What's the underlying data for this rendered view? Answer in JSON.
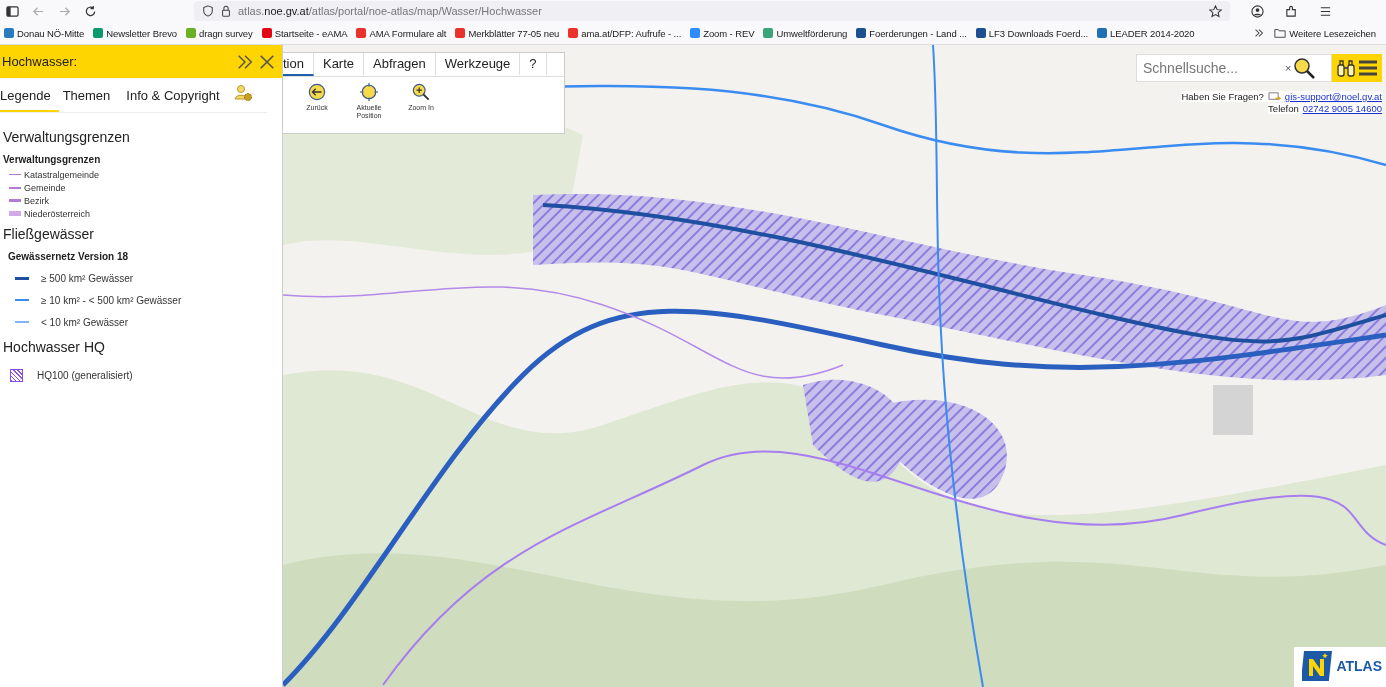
{
  "browser": {
    "url": "atlas.**noe.gv.at**/atlas/portal/noe-atlas/map/Wasser/Hochwasser",
    "bookmarks": [
      {
        "label": "Donau NÖ-Mitte",
        "color": "#2a7ac0"
      },
      {
        "label": "Newsletter Brevo",
        "color": "#0b996e"
      },
      {
        "label": "dragn survey",
        "color": "#6ab023"
      },
      {
        "label": "Startseite - eAMA",
        "color": "#e30613"
      },
      {
        "label": "AMA Formulare alt",
        "color": "#e8322b"
      },
      {
        "label": "Merkblätter 77-05 neu",
        "color": "#e8322b"
      },
      {
        "label": "ama.at/DFP: Aufrufe - ...",
        "color": "#e8322b"
      },
      {
        "label": "Zoom - REV",
        "color": "#2d8cff"
      },
      {
        "label": "Umweltförderung",
        "color": "#3aa57a"
      },
      {
        "label": "Foerderungen - Land ...",
        "color": "#1d4f91"
      },
      {
        "label": "LF3 Downloads Foerd...",
        "color": "#1d4f91"
      },
      {
        "label": "LEADER 2014-2020",
        "color": "#1f6fb5"
      }
    ],
    "other_bookmarks": "Weitere Lesezeichen"
  },
  "panel": {
    "title": "Hochwasser:",
    "tabs": [
      {
        "label": "Legende",
        "selected": true
      },
      {
        "label": "Themen",
        "selected": false
      },
      {
        "label": "Info & Copyright",
        "selected": false
      }
    ],
    "sections": [
      {
        "title": "Verwaltungsgrenzen",
        "subtitle": "Verwaltungsgrenzen",
        "items": [
          {
            "label": "Katastralgemeinde",
            "kind": "thin",
            "color": "#b57ad8"
          },
          {
            "label": "Gemeinde",
            "kind": "medium",
            "color": "#b57ad8"
          },
          {
            "label": "Bezirk",
            "kind": "thick",
            "color": "#b57ad8"
          },
          {
            "label": "Niederösterreich",
            "kind": "wide",
            "color": "#d2a8ea"
          }
        ]
      },
      {
        "title": "Fließgewässer",
        "subtitle": "Gewässernetz Version 18",
        "items": [
          {
            "label": "≥ 500 km² Gewässer",
            "kind": "thick",
            "color": "#1f4fa0"
          },
          {
            "label": "≥ 10 km² - < 500 km² Gewässer",
            "kind": "medium",
            "color": "#3b8cf0"
          },
          {
            "label": "< 10 km² Gewässer",
            "kind": "medium",
            "color": "#7fb6fa"
          }
        ]
      },
      {
        "title": "Hochwasser HQ",
        "items": [
          {
            "label": "HQ100 (generalisiert)",
            "kind": "hatch",
            "color": "#8a4de8"
          }
        ]
      }
    ]
  },
  "toolbar": {
    "tabs": [
      {
        "label": "tion",
        "selected": true
      },
      {
        "label": "Karte",
        "selected": false
      },
      {
        "label": "Abfragen",
        "selected": false
      },
      {
        "label": "Werkzeuge",
        "selected": false
      },
      {
        "label": "?",
        "selected": false
      }
    ],
    "tools": [
      {
        "label": "Zurück",
        "kind": "back"
      },
      {
        "label": "Aktuelle Position",
        "kind": "locate"
      },
      {
        "label": "Zoom In",
        "kind": "zoom"
      }
    ]
  },
  "search": {
    "placeholder": "Schnellsuche...",
    "clear": "×"
  },
  "help": {
    "question": "Haben Sie Fragen?",
    "email": "gis-support@noel.gv.at",
    "phone_label": "Telefon",
    "phone": "02742 9005 14600"
  },
  "logo": {
    "text": "ATLAS"
  }
}
